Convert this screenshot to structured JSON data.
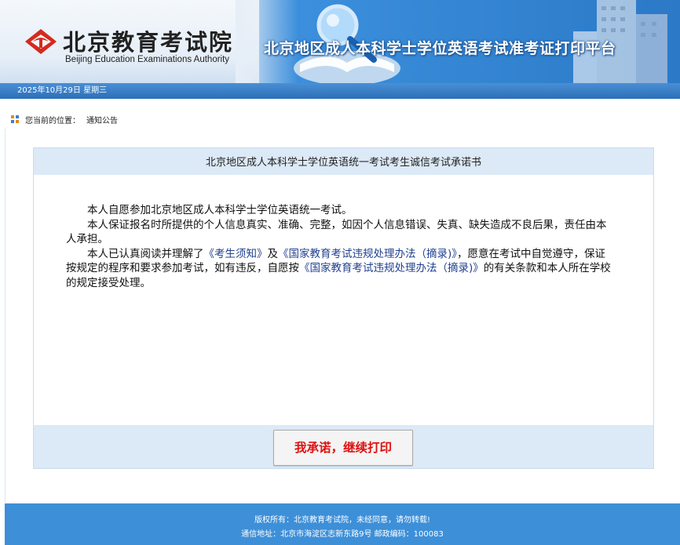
{
  "header": {
    "org_name_cn": "北京教育考试院",
    "org_name_en": "Beijing Education Examinations Authority",
    "platform_title": "北京地区成人本科学士学位英语考试准考证打印平台"
  },
  "datebar": {
    "date": "2025年10月29日  星期三"
  },
  "breadcrumb": {
    "label": "您当前的位置：",
    "current": "通知公告"
  },
  "panel": {
    "title": "北京地区成人本科学士学位英语统一考试考生诚信考试承诺书",
    "para1": "本人自愿参加北京地区成人本科学士学位英语统一考试。",
    "para2": "本人保证报名时所提供的个人信息真实、准确、完整，如因个人信息错误、失真、缺失造成不良后果，责任由本人承担。",
    "para3_a": "本人已认真阅读并理解了",
    "link1": "《考生须知》",
    "para3_b": "及",
    "link2": "《国家教育考试违规处理办法（摘录)》",
    "para3_c": "，愿意在考试中自觉遵守，保证按规定的程序和要求参加考试，如有违反，自愿按",
    "link3": "《国家教育考试违规处理办法（摘录)》",
    "para3_d": "的有关条款和本人所在学校的规定接受处理。",
    "confirm_button": "我承诺，继续打印"
  },
  "footer": {
    "copyright": "版权所有：北京教育考试院，未经同意，请勿转载!",
    "address": "通信地址：北京市海淀区志新东路9号 邮政编码：100083"
  },
  "colors": {
    "banner_blue": "#2a78c9",
    "footer_blue": "#3d8fd8",
    "panel_header_bg": "#dce9f6",
    "button_text_red": "#e01010",
    "link_blue": "#1f3f8f"
  },
  "icons": [
    "beijing-exam-authority-logo-icon",
    "magnifier-book-decoration",
    "building-decoration",
    "breadcrumb-grid-icon"
  ]
}
